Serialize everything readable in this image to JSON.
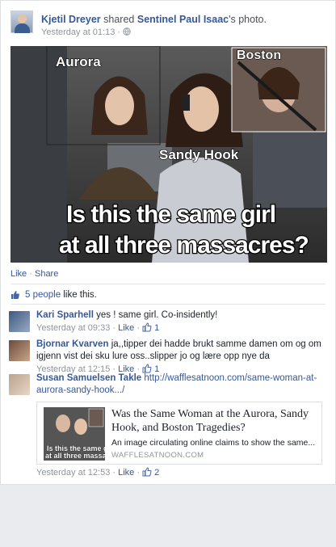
{
  "post": {
    "author": "Kjetil Dreyer",
    "action_text": "shared",
    "shared_from": "Sentinel Paul Isaac",
    "shared_suffix": "'s photo.",
    "timestamp": "Yesterday at 01:13",
    "audience_icon": "globe-icon"
  },
  "photo": {
    "label_top_left": "Aurora",
    "label_top_right": "Boston",
    "label_center": "Sandy Hook",
    "caption_line1": "Is this the same girl",
    "caption_line2": "at all three massacres?"
  },
  "actions": {
    "like": "Like",
    "separator": "·",
    "share": "Share"
  },
  "likes": {
    "count_text": "5 people",
    "suffix": "like this."
  },
  "comments": [
    {
      "name": "Kari Sparhell",
      "text": "yes ! same girl. Co-insidently!",
      "time": "Yesterday at 09:33",
      "like": "Like",
      "likes": "1"
    },
    {
      "name": "Bjornar Kvarven",
      "text": "ja,,tipper dei hadde brukt samme damen om og om igjenn vist dei sku lure oss..slipper jo og lære opp nye da",
      "time": "Yesterday at 12:15",
      "like": "Like",
      "likes": "1"
    },
    {
      "name": "Susan Samuelsen Takle",
      "text": "http://wafflesatnoon.com/same-woman-at-aurora-sandy-hook.../",
      "time": "Yesterday at 12:53",
      "like": "Like",
      "likes": "2",
      "preview": {
        "title": "Was the Same Woman at the Aurora, Sandy Hook, and Boston Tragedies?",
        "description": "An image circulating online claims to show the same...",
        "site": "WAFFLESATNOON.COM",
        "thumb_caption_line1": "Is this the same gi",
        "thumb_caption_line2": "at all three massacr"
      }
    }
  ],
  "colors": {
    "link": "#365899",
    "meta": "#90949c",
    "like_blue": "#4267b2"
  }
}
